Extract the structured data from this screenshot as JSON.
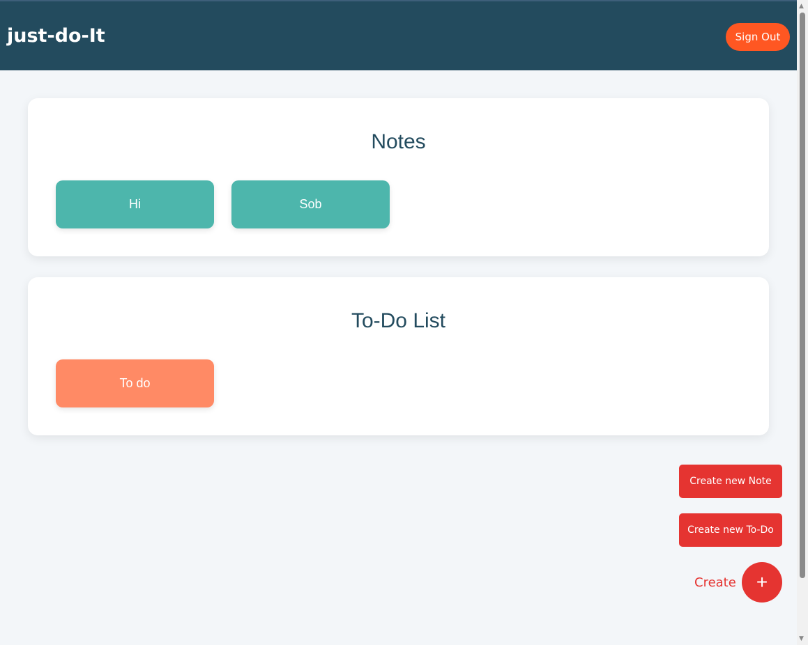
{
  "header": {
    "title": "just-do-It",
    "sign_out": "Sign Out"
  },
  "notes": {
    "title": "Notes",
    "items": [
      {
        "label": "Hi"
      },
      {
        "label": "Sob"
      }
    ]
  },
  "todos": {
    "title": "To-Do List",
    "items": [
      {
        "label": "To do"
      }
    ]
  },
  "actions": {
    "create_note": "Create new Note",
    "create_todo": "Create new To-Do",
    "create_label": "Create",
    "fab_symbol": "+"
  },
  "colors": {
    "header": "#234b5e",
    "accent": "#ff5722",
    "note": "#4db6ac",
    "todo": "#ff8a65",
    "action": "#e53431"
  }
}
